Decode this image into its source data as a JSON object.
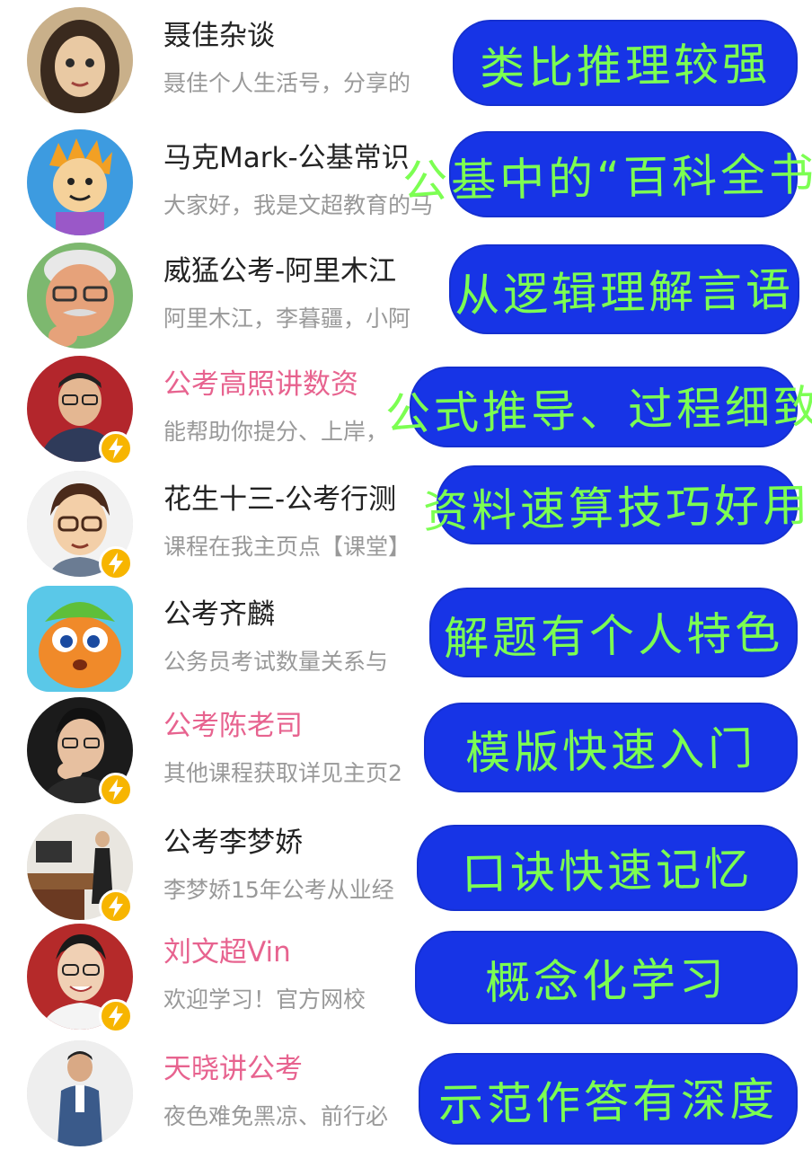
{
  "accounts": [
    {
      "name": "聂佳杂谈",
      "desc": "聂佳个人生活号，分享的",
      "verified": false,
      "name_color": "default",
      "annotation": "类比推理较强",
      "avatar_icon": "cartoon-woman-avatar"
    },
    {
      "name": "马克Mark-公基常识",
      "desc": "大家好，我是文超教育的马",
      "verified": false,
      "name_color": "default",
      "annotation": "公基中的“百科全书”",
      "avatar_icon": "cartoon-boy-avatar"
    },
    {
      "name": "威猛公考-阿里木江",
      "desc": "阿里木江，李暮疆，小阿",
      "verified": false,
      "name_color": "default",
      "annotation": "从逻辑理解言语",
      "avatar_icon": "cartoon-old-man-avatar"
    },
    {
      "name": "公考高照讲数资",
      "desc": "能帮助你提分、上岸，",
      "verified": true,
      "name_color": "pink",
      "annotation": "公式推导、过程细致",
      "avatar_icon": "man-glasses-photo-avatar"
    },
    {
      "name": "花生十三-公考行测",
      "desc": "课程在我主页点【课堂】",
      "verified": true,
      "name_color": "default",
      "annotation": "资料速算技巧好用",
      "avatar_icon": "cartoon-man-glasses-avatar"
    },
    {
      "name": "公考齐麟",
      "desc": "公务员考试数量关系与",
      "verified": false,
      "name_color": "default",
      "annotation": "解题有个人特色",
      "avatar_icon": "cartoon-mascot-avatar"
    },
    {
      "name": "公考陈老司",
      "desc": "其他课程获取详见主页2",
      "verified": true,
      "name_color": "pink",
      "annotation": "模版快速入门",
      "avatar_icon": "man-thinking-photo-avatar"
    },
    {
      "name": "公考李梦娇",
      "desc": "李梦娇15年公考从业经",
      "verified": true,
      "name_color": "default",
      "annotation": "口诀快速记忆",
      "avatar_icon": "classroom-photo-avatar"
    },
    {
      "name": "刘文超Vin",
      "desc": "欢迎学习！官方网校",
      "verified": true,
      "name_color": "pink",
      "annotation": "概念化学习",
      "avatar_icon": "smiling-man-photo-avatar"
    },
    {
      "name": "天晓讲公考",
      "desc": "夜色难免黑凉、前行必",
      "verified": false,
      "name_color": "pink",
      "annotation": "示范作答有深度",
      "avatar_icon": "standing-man-photo-avatar"
    }
  ],
  "colors": {
    "name_default": "#222222",
    "name_pink": "#e7638f",
    "desc": "#999999",
    "annotation_bg": "#1734e6",
    "annotation_text": "#7cff52",
    "badge": "#f7b500"
  }
}
